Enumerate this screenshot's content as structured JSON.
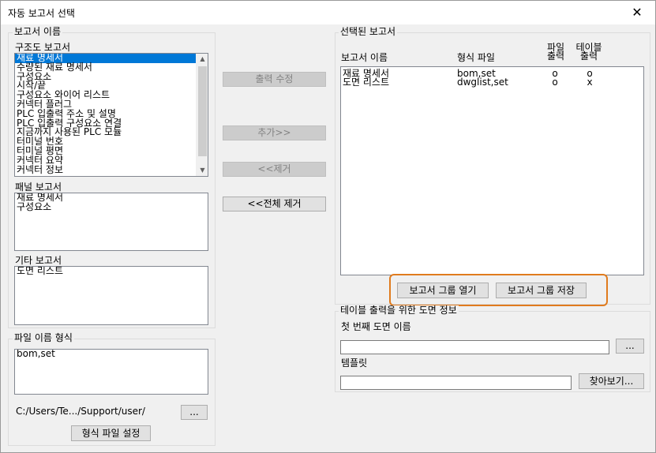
{
  "window": {
    "title": "자동 보고서 선택",
    "close_glyph": "✕"
  },
  "report_names": {
    "legend": "보고서 이름",
    "structure": {
      "label": "구조도 보고서",
      "items": [
        "재료 명세서",
        "수량된 재료 명세서",
        "구성요소",
        "시작/끝",
        "구성요소 와이어 리스트",
        "커넥터 플러그",
        "PLC 입출력 주소 및 설명",
        "PLC 입출력 구성요소 연결",
        "지금까지 사용된 PLC 모듈",
        "터미널 번호",
        "터미널 평면",
        "커넥터 요약",
        "커넥터 정보"
      ],
      "selected_index": 0
    },
    "panel": {
      "label": "패널 보고서",
      "items": [
        "재료 명세서",
        "구성요소"
      ]
    },
    "other": {
      "label": "기타 보고서",
      "items": [
        "도면 리스트"
      ]
    }
  },
  "file_name_format": {
    "legend": "파일 이름 형식",
    "items": [
      "bom,set"
    ],
    "path": "C:/Users/Te.../Support/user/",
    "browse_label": "...",
    "set_button": "형식 파일 설정"
  },
  "middle_buttons": {
    "edit_output": "출력 수정",
    "add": "추가>>",
    "remove": "<<제거",
    "remove_all": "<<전체 제거"
  },
  "selected_reports": {
    "legend": "선택된 보고서",
    "columns": {
      "name": "보고서 이름",
      "format": "형식 파일",
      "file_out": "파일\n출력",
      "table_out": "테이블\n출력"
    },
    "rows": [
      {
        "name": "재료 명세서",
        "format": "bom,set",
        "file_out": "o",
        "table_out": "o"
      },
      {
        "name": "도면 리스트",
        "format": "dwglist,set",
        "file_out": "o",
        "table_out": "x"
      }
    ],
    "open_group": "보고서 그룹 열기",
    "save_group": "보고서 그룹 저장",
    "highlight_color": "#e07b1e"
  },
  "table_output": {
    "legend": "테이블 출력을 위한 도면 정보",
    "first_drawing_label": "첫 번째 도면 이름",
    "first_drawing_value": "",
    "first_browse_label": "...",
    "template_label": "템플릿",
    "template_value": "",
    "find_button": "찾아보기..."
  },
  "colors": {
    "selection": "#0078d7",
    "face": "#f0f0f0"
  }
}
